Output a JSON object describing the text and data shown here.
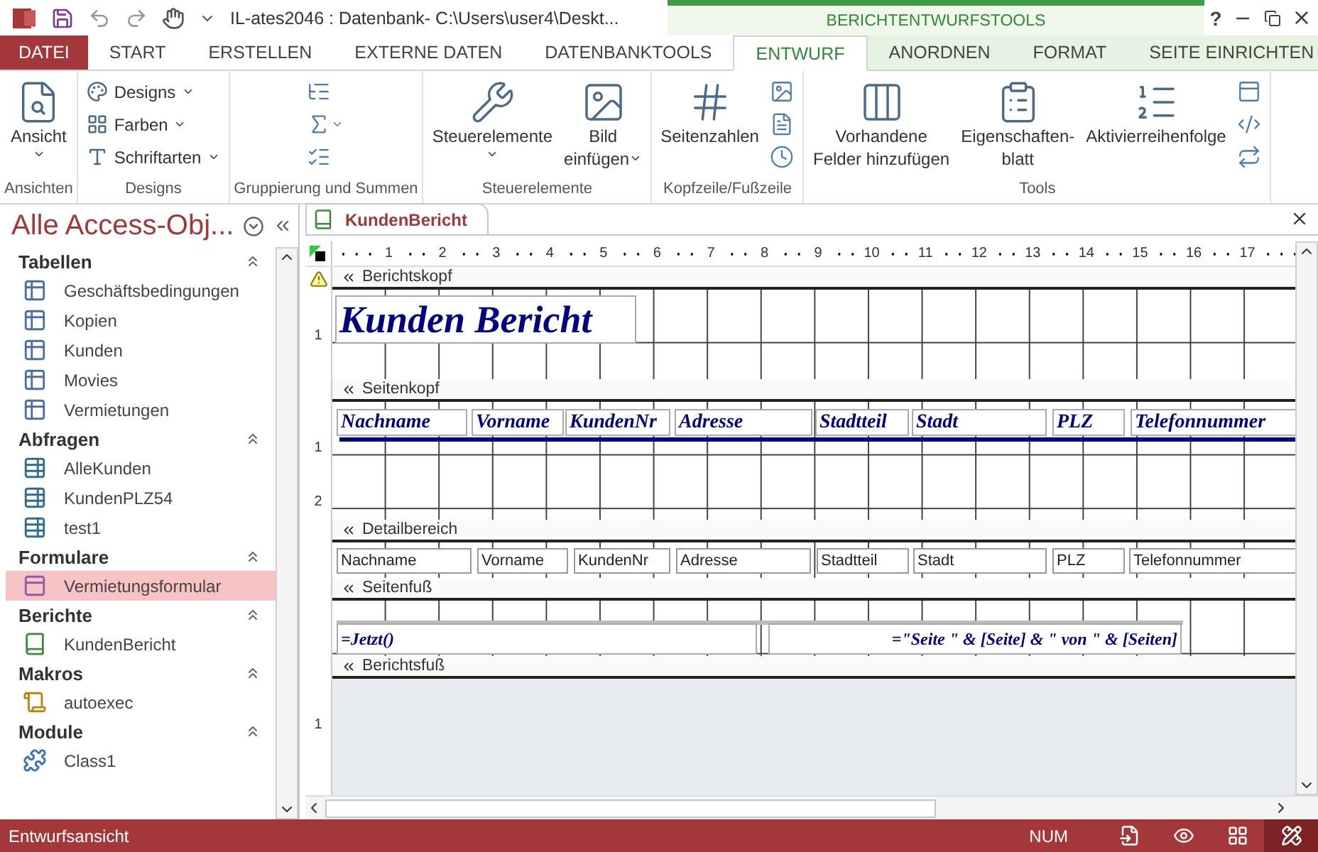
{
  "window": {
    "title": "IL-ates2046 : Datenbank- C:\\Users\\user4\\Deskt...",
    "context_group": "BERICHTENTWURFSTOOLS",
    "help": "?"
  },
  "tabs": [
    {
      "label": "DATEI",
      "kind": "file",
      "selected": false
    },
    {
      "label": "START",
      "kind": "normal",
      "selected": false
    },
    {
      "label": "ERSTELLEN",
      "kind": "normal",
      "selected": false
    },
    {
      "label": "EXTERNE DATEN",
      "kind": "normal",
      "selected": false
    },
    {
      "label": "DATENBANKTOOLS",
      "kind": "normal",
      "selected": false
    },
    {
      "label": "ENTWURF",
      "kind": "context",
      "selected": true
    },
    {
      "label": "ANORDNEN",
      "kind": "context",
      "selected": false
    },
    {
      "label": "FORMAT",
      "kind": "context",
      "selected": false
    },
    {
      "label": "SEITE EINRICHTEN",
      "kind": "context",
      "selected": false
    }
  ],
  "ribbon": [
    {
      "label": "Ansichten",
      "buttons": [
        {
          "kind": "large",
          "lines": [
            "Ansicht"
          ],
          "dropdown": true
        }
      ]
    },
    {
      "label": "Designs",
      "buttons": [
        {
          "kind": "small",
          "lines": [
            "Designs"
          ],
          "dropdown": true
        },
        {
          "kind": "small",
          "lines": [
            "Farben"
          ],
          "dropdown": true
        },
        {
          "kind": "small",
          "lines": [
            "Schriftarten"
          ],
          "dropdown": true
        }
      ]
    },
    {
      "label": "Gruppierung und Summen",
      "buttons": [
        {
          "kind": "icon"
        },
        {
          "kind": "icon",
          "dropdown": true
        },
        {
          "kind": "icon"
        }
      ]
    },
    {
      "label": "Steuerelemente",
      "buttons": [
        {
          "kind": "large",
          "lines": [
            "Steuerelemente"
          ],
          "dropdown": true
        },
        {
          "kind": "large",
          "lines": [
            "Bild",
            "einfügen"
          ],
          "dropdown": true
        }
      ]
    },
    {
      "label": "Kopfzeile/Fußzeile",
      "buttons": [
        {
          "kind": "large",
          "lines": [
            "Seitenzahlen"
          ]
        },
        {
          "kind": "icon"
        },
        {
          "kind": "icon"
        },
        {
          "kind": "icon"
        }
      ]
    },
    {
      "label": "Tools",
      "buttons": [
        {
          "kind": "large",
          "lines": [
            "Vorhandene",
            "Felder hinzufügen"
          ]
        },
        {
          "kind": "large",
          "lines": [
            "Eigenschaften-",
            "blatt"
          ]
        },
        {
          "kind": "large",
          "lines": [
            "Aktivierreihenfolge"
          ]
        },
        {
          "kind": "icon"
        },
        {
          "kind": "icon"
        },
        {
          "kind": "icon"
        }
      ]
    }
  ],
  "nav": {
    "title": "Alle Access-Obj...",
    "groups": [
      {
        "label": "Tabellen",
        "items": [
          {
            "label": "Geschäftsbedingungen",
            "kind": "table",
            "selected": false
          },
          {
            "label": "Kopien",
            "kind": "table",
            "selected": false
          },
          {
            "label": "Kunden",
            "kind": "table",
            "selected": false
          },
          {
            "label": "Movies",
            "kind": "table",
            "selected": false
          },
          {
            "label": "Vermietungen",
            "kind": "table",
            "selected": false
          }
        ]
      },
      {
        "label": "Abfragen",
        "items": [
          {
            "label": "AlleKunden",
            "kind": "query",
            "selected": false
          },
          {
            "label": "KundenPLZ54",
            "kind": "query",
            "selected": false
          },
          {
            "label": "test1",
            "kind": "query",
            "selected": false
          }
        ]
      },
      {
        "label": "Formulare",
        "items": [
          {
            "label": "Vermietungsformular",
            "kind": "form",
            "selected": true
          }
        ]
      },
      {
        "label": "Berichte",
        "items": [
          {
            "label": "KundenBericht",
            "kind": "report",
            "selected": false
          }
        ]
      },
      {
        "label": "Makros",
        "items": [
          {
            "label": "autoexec",
            "kind": "macro",
            "selected": false
          }
        ]
      },
      {
        "label": "Module",
        "items": [
          {
            "label": "Class1",
            "kind": "module",
            "selected": false
          }
        ]
      }
    ]
  },
  "document": {
    "tab": "KundenBericht",
    "ruler": [
      "1",
      "2",
      "3",
      "4",
      "5",
      "6",
      "7",
      "8",
      "9",
      "10",
      "11",
      "12",
      "13",
      "14",
      "15",
      "16",
      "17"
    ],
    "sections": [
      {
        "name": "Berichtskopf",
        "kind": "report_header",
        "ruler": [
          "1"
        ],
        "controls": [
          {
            "kind": "title",
            "text": "Kunden Bericht"
          }
        ]
      },
      {
        "name": "Seitenkopf",
        "kind": "page_header",
        "ruler": [
          "1",
          "2"
        ],
        "controls": [
          {
            "kind": "label",
            "text": "Nachname"
          },
          {
            "kind": "label",
            "text": "Vorname"
          },
          {
            "kind": "label",
            "text": "KundenNr"
          },
          {
            "kind": "label",
            "text": "Adresse"
          },
          {
            "kind": "label",
            "text": "Stadtteil"
          },
          {
            "kind": "label",
            "text": "Stadt"
          },
          {
            "kind": "label",
            "text": "PLZ"
          },
          {
            "kind": "label",
            "text": "Telefonnummer"
          }
        ]
      },
      {
        "name": "Detailbereich",
        "kind": "detail",
        "controls": [
          {
            "kind": "field",
            "text": "Nachname"
          },
          {
            "kind": "field",
            "text": "Vorname"
          },
          {
            "kind": "field",
            "text": "KundenNr"
          },
          {
            "kind": "field",
            "text": "Adresse"
          },
          {
            "kind": "field",
            "text": "Stadtteil"
          },
          {
            "kind": "field",
            "text": "Stadt"
          },
          {
            "kind": "field",
            "text": "PLZ"
          },
          {
            "kind": "field",
            "text": "Telefonnummer"
          }
        ]
      },
      {
        "name": "Seitenfuß",
        "kind": "page_footer",
        "controls": [
          {
            "kind": "expression",
            "text": "=Jetzt()"
          },
          {
            "kind": "expression_right",
            "text": "=\"Seite \" & [Seite] & \" von \" & [Seiten]"
          }
        ]
      },
      {
        "name": "Berichtsfuß",
        "kind": "report_footer",
        "ruler": [
          "1"
        ]
      }
    ]
  },
  "status_bar": {
    "text": "Entwurfsansicht",
    "indicator": "NUM",
    "views": [
      {
        "kind": "report",
        "selected": false
      },
      {
        "kind": "preview",
        "selected": false
      },
      {
        "kind": "layout",
        "selected": false
      },
      {
        "kind": "design",
        "selected": true
      }
    ]
  }
}
